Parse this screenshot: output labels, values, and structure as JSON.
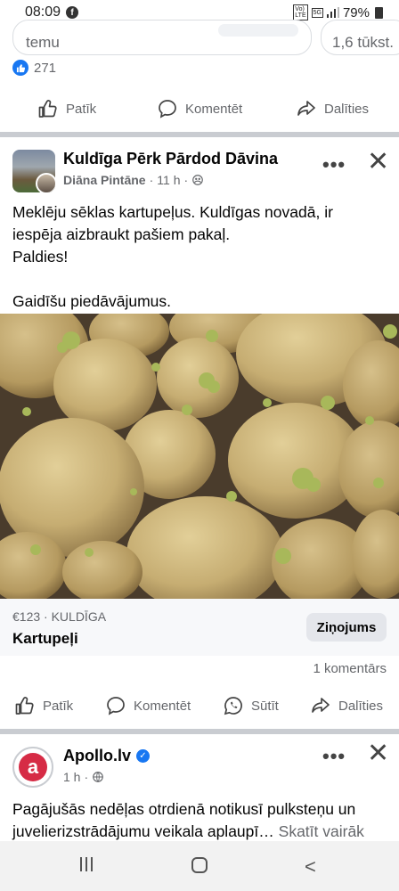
{
  "status_bar": {
    "time": "08:09",
    "app_badge": "f",
    "network_badge_1": "Vo)",
    "network_badge_2": "LTE",
    "network_5g": "5G",
    "battery": "79%"
  },
  "prev_post": {
    "field_text": "temu",
    "count_chip": "1,6 tūkst.",
    "like_count": "271"
  },
  "actions_top": {
    "like": "Patīk",
    "comment": "Komentēt",
    "share": "Dalīties"
  },
  "post": {
    "group_name": "Kuldīga Pērk Pārdod Dāvina",
    "author": "Diāna Pintāne",
    "time": "11 h",
    "more": "•••",
    "close": "✕",
    "text_lines": [
      "Meklēju sēklas kartupeļus. Kuldīgas novadā, ir",
      "iespēja aizbraukt pašiem pakaļ.",
      "Paldies!",
      "",
      "Gaidīšu piedāvājumus."
    ]
  },
  "marketplace": {
    "price_location": "€123 · KULDĪGA",
    "title": "Kartupeļi",
    "message_button": "Ziņojums"
  },
  "comment_count": "1 komentārs",
  "actions_bottom": {
    "like": "Patīk",
    "comment": "Komentēt",
    "send": "Sūtīt",
    "share": "Dalīties"
  },
  "next_post": {
    "avatar_letter": "a",
    "page_name": "Apollo.lv",
    "verified": "✓",
    "time": "1 h",
    "text_line1": "Pagājušās nedēļas otrdienā notikusī pulksteņu un",
    "text_line2": "juvelierizstrādājumu veikala aplaupī…",
    "see_more": "Skatīt vairāk",
    "more": "•••",
    "close": "✕"
  },
  "colors": {
    "accent": "#1877f2",
    "secondary_text": "#65676b",
    "apollo_red": "#d62b45"
  }
}
